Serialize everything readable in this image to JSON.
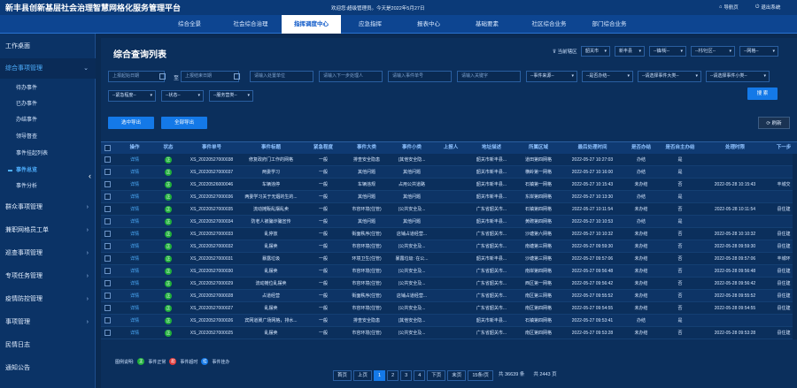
{
  "app_title": "新丰县创新基层社会治理智慧网格化服务管理平台",
  "welcome": "欢迎您:超级管理员。今天是2022年5月27日",
  "topright": {
    "nav": "导航页",
    "logout": "退出系统"
  },
  "nav_tabs": [
    "综合全景",
    "社会综合治理",
    "指挥调度中心",
    "应急指挥",
    "报表中心",
    "基础要素",
    "社区综合业务",
    "部门综合业务"
  ],
  "nav_active": "指挥调度中心",
  "sidebar": {
    "items": [
      "工作桌面",
      "综合事项管理",
      "群众事项管理",
      "兼职网格员工单",
      "巡查事项管理",
      "专项任务管理",
      "疫情防控管理",
      "事项管理",
      "民情日志",
      "通知公告"
    ],
    "subitems": [
      "待办事件",
      "已办事件",
      "办结事件",
      "领导督查",
      "事件挂起列表",
      "事件总览",
      "事件分析"
    ],
    "active_sub": "事件总览"
  },
  "panel_title": "综合查询列表",
  "area": {
    "label": "当前辖区",
    "selects": [
      "韶关市",
      "新丰县",
      "--镇/街--",
      "--村/社区--",
      "--网格--"
    ]
  },
  "filters": {
    "start_date": "上报起始日期",
    "date_sep": "至",
    "end_date": "上报结束日期",
    "handle_unit": "请输入处置单位",
    "next_handler": "请输入下一步处理人",
    "event_no": "请输入事件单号",
    "keyword": "请输入关键字",
    "event_source": "--事件来源--",
    "is_done": "--是否办结--",
    "category_big": "--请选择事件大类--",
    "category_small": "--请选择事件小类--",
    "urgency": "--紧急程度--",
    "status": "--状态--",
    "service_type": "--服务营类--",
    "search": "搜 索"
  },
  "buttons": {
    "export_selected": "选中导出",
    "export_all": "全部导出",
    "refresh": "刷新"
  },
  "table": {
    "headers": [
      "操作",
      "状态",
      "事件单号",
      "事件标题",
      "紧急程度",
      "事件大类",
      "事件小类",
      "上报人",
      "地址描述",
      "所属区域",
      "最后处理时间",
      "是否办结",
      "是否自主办结",
      "处理时限",
      "下一步"
    ],
    "rows": [
      {
        "op": "详情",
        "status": "正",
        "no": "XS_20220527000038",
        "title": "修复政府门工作的网格",
        "urgency": "一般",
        "big": "排查安全隐患",
        "small": "(其他安全隐...",
        "reporter": "",
        "addr": "韶关市新丰县...",
        "area": "道田第四网格",
        "time": "2022-05-27 10:27:03",
        "done": "办结",
        "self": "是",
        "limit": "",
        "next": ""
      },
      {
        "op": "详情",
        "status": "正",
        "no": "XS_20220527000037",
        "title": "两委学习",
        "urgency": "一般",
        "big": "其他问题",
        "small": "其他问题",
        "reporter": "",
        "addr": "韶关市新丰县...",
        "area": "横岭第一网格",
        "time": "2022-05-27 10:16:00",
        "done": "办结",
        "self": "是",
        "limit": "",
        "next": ""
      },
      {
        "op": "详情",
        "status": "正",
        "no": "XS_20220526000046",
        "title": "车辆违停",
        "urgency": "一般",
        "big": "车辆违规",
        "small": "占用公共道路",
        "reporter": "",
        "addr": "韶关市新丰县...",
        "area": "石镇第一网格",
        "time": "2022-05-27 10:15:43",
        "done": "未办结",
        "self": "否",
        "limit": "2022-05-28 10:15:43",
        "next": "丰城交"
      },
      {
        "op": "详情",
        "status": "正",
        "no": "XS_20220527000036",
        "title": "两委学习关于无烟的生的...",
        "urgency": "一般",
        "big": "其他问题",
        "small": "其他问题",
        "reporter": "",
        "addr": "韶关市新丰县...",
        "area": "东岸第四网格",
        "time": "2022-05-27 10:13:30",
        "done": "办结",
        "self": "是",
        "limit": "",
        "next": ""
      },
      {
        "op": "详情",
        "status": "正",
        "no": "XS_20220527000035",
        "title": "流动摊贩乱摆乱卖",
        "urgency": "一般",
        "big": "市容环境(住管)",
        "small": "(公共安全及...",
        "reporter": "",
        "addr": "广东省韶关市...",
        "area": "石镇第四网格",
        "time": "2022-05-27 10:11:54",
        "done": "未办结",
        "self": "否",
        "limit": "2022-05-28 10:11:54",
        "next": "县住建"
      },
      {
        "op": "详情",
        "status": "正",
        "no": "XS_20220527000034",
        "title": "防老人被骗诈骗宣传",
        "urgency": "一般",
        "big": "其他问题",
        "small": "其他问题",
        "reporter": "",
        "addr": "韶关市新丰县...",
        "area": "黄磜第四网格",
        "time": "2022-05-27 10:10:53",
        "done": "办结",
        "self": "是",
        "limit": "",
        "next": ""
      },
      {
        "op": "详情",
        "status": "正",
        "no": "XS_20220527000033",
        "title": "乱停放",
        "urgency": "一般",
        "big": "街面秩序(住管)",
        "small": "店铺占道经营...",
        "reporter": "",
        "addr": "广东省韶关市...",
        "area": "沙塘第六网格",
        "time": "2022-05-27 10:10:32",
        "done": "未办结",
        "self": "否",
        "limit": "2022-05-28 10:10:32",
        "next": "县住建"
      },
      {
        "op": "详情",
        "status": "正",
        "no": "XS_20220527000032",
        "title": "乱摆卖",
        "urgency": "一般",
        "big": "市容环境(住管)",
        "small": "(公共安全及...",
        "reporter": "",
        "addr": "广东省韶关市...",
        "area": "南塘第三网格",
        "time": "2022-05-27 09:59:30",
        "done": "未办结",
        "self": "否",
        "limit": "2022-05-28 09:59:30",
        "next": "县住建"
      },
      {
        "op": "详情",
        "status": "正",
        "no": "XS_20220527000031",
        "title": "暴露垃圾",
        "urgency": "一般",
        "big": "环境卫生(住管)",
        "small": "暴露垃圾: 在公...",
        "reporter": "",
        "addr": "韶关市新丰县...",
        "area": "沙塘第三网格",
        "time": "2022-05-27 09:57:06",
        "done": "未办结",
        "self": "否",
        "limit": "2022-05-28 09:57:06",
        "next": "丰城环"
      },
      {
        "op": "详情",
        "status": "正",
        "no": "XS_20220527000030",
        "title": "乱摆卖",
        "urgency": "一般",
        "big": "市容环境(住管)",
        "small": "(公共安全及...",
        "reporter": "",
        "addr": "广东省韶关市...",
        "area": "南岸第四网格",
        "time": "2022-05-27 09:56:48",
        "done": "未办结",
        "self": "否",
        "limit": "2022-05-28 09:56:48",
        "next": "县住建"
      },
      {
        "op": "详情",
        "status": "正",
        "no": "XS_20220527000029",
        "title": "流动摊位乱摆卖",
        "urgency": "一般",
        "big": "市容环境(住管)",
        "small": "(公共安全及...",
        "reporter": "",
        "addr": "广东省韶关市...",
        "area": "西区第一网格",
        "time": "2022-05-27 09:56:42",
        "done": "未办结",
        "self": "否",
        "limit": "2022-05-28 09:56:42",
        "next": "县住建"
      },
      {
        "op": "详情",
        "status": "正",
        "no": "XS_20220527000028",
        "title": "占道经营",
        "urgency": "一般",
        "big": "街面秩序(住管)",
        "small": "店铺占道经营...",
        "reporter": "",
        "addr": "广东省韶关市...",
        "area": "南区第三网格",
        "time": "2022-05-27 09:55:52",
        "done": "未办结",
        "self": "否",
        "limit": "2022-05-28 09:55:52",
        "next": "县住建"
      },
      {
        "op": "详情",
        "status": "正",
        "no": "XS_20220527000027",
        "title": "乱摆卖",
        "urgency": "一般",
        "big": "市容环境(住管)",
        "small": "(公共安全及...",
        "reporter": "",
        "addr": "广东省韶关市...",
        "area": "南区第四网格",
        "time": "2022-05-27 09:54:55",
        "done": "未办结",
        "self": "否",
        "limit": "2022-05-28 09:54:55",
        "next": "县住建"
      },
      {
        "op": "详情",
        "status": "正",
        "no": "XS_20220527000026",
        "title": "宾网道冀广场网格，排水...",
        "urgency": "一般",
        "big": "排查安全隐患",
        "small": "(其他安全隐...",
        "reporter": "",
        "addr": "韶关市新丰县...",
        "area": "石镇第四网格",
        "time": "2022-05-27 09:53:41",
        "done": "办结",
        "self": "是",
        "limit": "",
        "next": ""
      },
      {
        "op": "详情",
        "status": "正",
        "no": "XS_20220527000025",
        "title": "乱摆卖",
        "urgency": "一般",
        "big": "市容环境(住管)",
        "small": "(公共安全及...",
        "reporter": "",
        "addr": "广东省韶关市...",
        "area": "南区第四网格",
        "time": "2022-05-27 09:53:28",
        "done": "未办结",
        "self": "否",
        "limit": "2022-05-28 09:53:28",
        "next": "县住建"
      }
    ]
  },
  "legend": {
    "label": "图例说明:",
    "items": [
      {
        "mark": "正",
        "text": "事件正常",
        "color": "#1fae3a"
      },
      {
        "mark": "超",
        "text": "事件超时",
        "color": "#e03a3a"
      },
      {
        "mark": "挂",
        "text": "事件挂办",
        "color": "#1479e8"
      }
    ]
  },
  "pager": {
    "first": "首页",
    "prev": "上页",
    "pages": [
      "1",
      "2",
      "3",
      "4"
    ],
    "current": "1",
    "next": "下页",
    "last": "末页",
    "page_size": "15条/页",
    "total": "共 36639 条",
    "pages_total": "共 2443 页"
  },
  "colors": {
    "accent": "#1479e8",
    "bg": "#0a2a52",
    "ok": "#1fae3a",
    "late": "#e03a3a"
  }
}
